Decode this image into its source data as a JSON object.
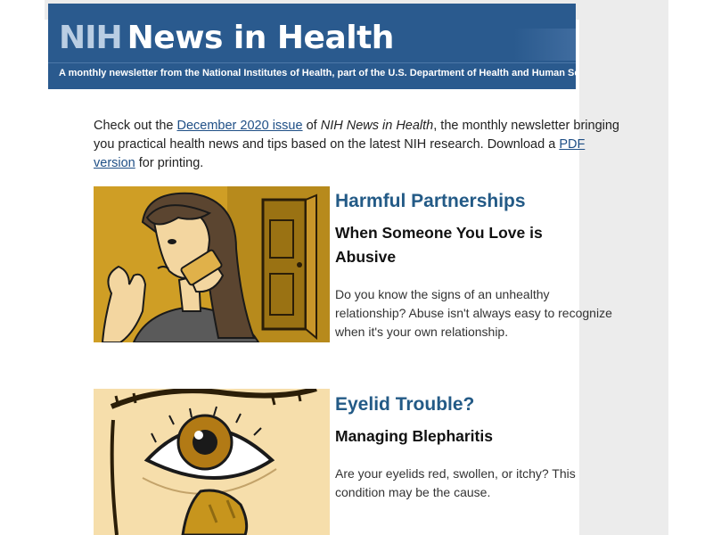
{
  "banner": {
    "logo_nih": "NIH",
    "logo_title": "News in Health",
    "tagline": "A monthly newsletter from the National Institutes of Health, part of the U.S. Department of Health and Human Services"
  },
  "intro": {
    "text_1": "Check out the ",
    "issue_link": "December 2020 issue",
    "text_2": " of ",
    "publication": "NIH News in Health",
    "text_3": ", the monthly newsletter bringing you practical health news and tips based on the latest NIH research. Download a ",
    "pdf_link": "PDF version",
    "text_4": " for printing."
  },
  "articles": [
    {
      "title": "Harmful Partnerships",
      "subtitle": "When Someone You Love is Abusive",
      "description": "Do you know the signs of an unhealthy relationship? Abuse isn't always easy to recognize when it's your own relationship.",
      "image_icon": "woman-on-phone-illustration"
    },
    {
      "title": "Eyelid Trouble?",
      "subtitle": "Managing Blepharitis",
      "description": "Are your eyelids red, swollen, or itchy? This condition may be the cause.",
      "image_icon": "eye-illustration"
    }
  ],
  "colors": {
    "banner_bg": "#2a5a8e",
    "title_blue": "#235a86",
    "link_blue": "#1f4f86",
    "page_gray": "#ececec"
  }
}
